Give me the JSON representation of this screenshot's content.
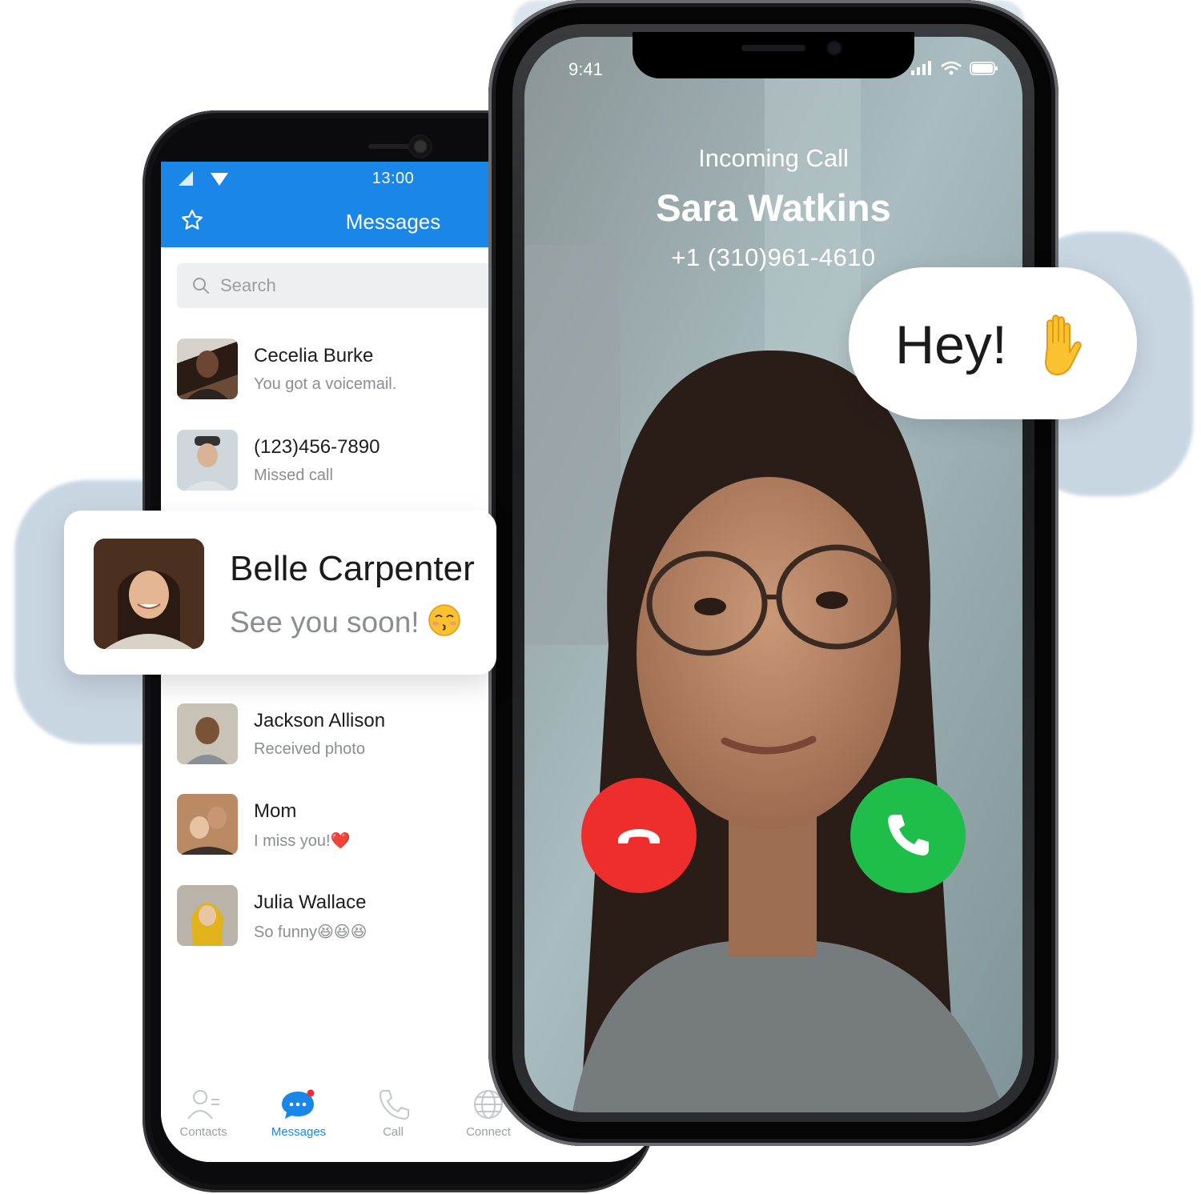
{
  "android": {
    "status_time": "13:00",
    "app_title": "Messages",
    "search_placeholder": "Search",
    "conversations": [
      {
        "name": "Cecelia Burke",
        "preview": "You got a voicemail.",
        "emoji": ""
      },
      {
        "name": "(123)456-7890",
        "preview": "Missed call",
        "emoji": ""
      },
      {
        "name": "Jackson Allison",
        "preview": "Received photo",
        "emoji": ""
      },
      {
        "name": "Mom",
        "preview": "I miss you!",
        "emoji": "❤️"
      },
      {
        "name": "Julia Wallace",
        "preview": "So funny",
        "emoji": "😆😆😆"
      }
    ],
    "tabs": [
      {
        "label": "Contacts",
        "icon": "contacts-icon",
        "active": false
      },
      {
        "label": "Messages",
        "icon": "chat-bubble-icon",
        "active": true
      },
      {
        "label": "Call",
        "icon": "phone-icon",
        "active": false
      },
      {
        "label": "Connect",
        "icon": "globe-icon",
        "active": false
      }
    ]
  },
  "iphone": {
    "status_time": "9:41",
    "call_status": "Incoming Call",
    "caller_name": "Sara Watkins",
    "caller_number": "+1 (310)961-4610"
  },
  "floating_cards": {
    "hey_text": "Hey!",
    "hey_emoji": "raised-hand",
    "belle_name": "Belle Carpenter",
    "belle_message": "See you soon!",
    "belle_emoji": "kissing-face"
  },
  "colors": {
    "brand_blue": "#1a87e8",
    "decline_red": "#ee2d2d",
    "accept_green": "#1fbd4a",
    "halo_blue": "#9cb6cc"
  }
}
